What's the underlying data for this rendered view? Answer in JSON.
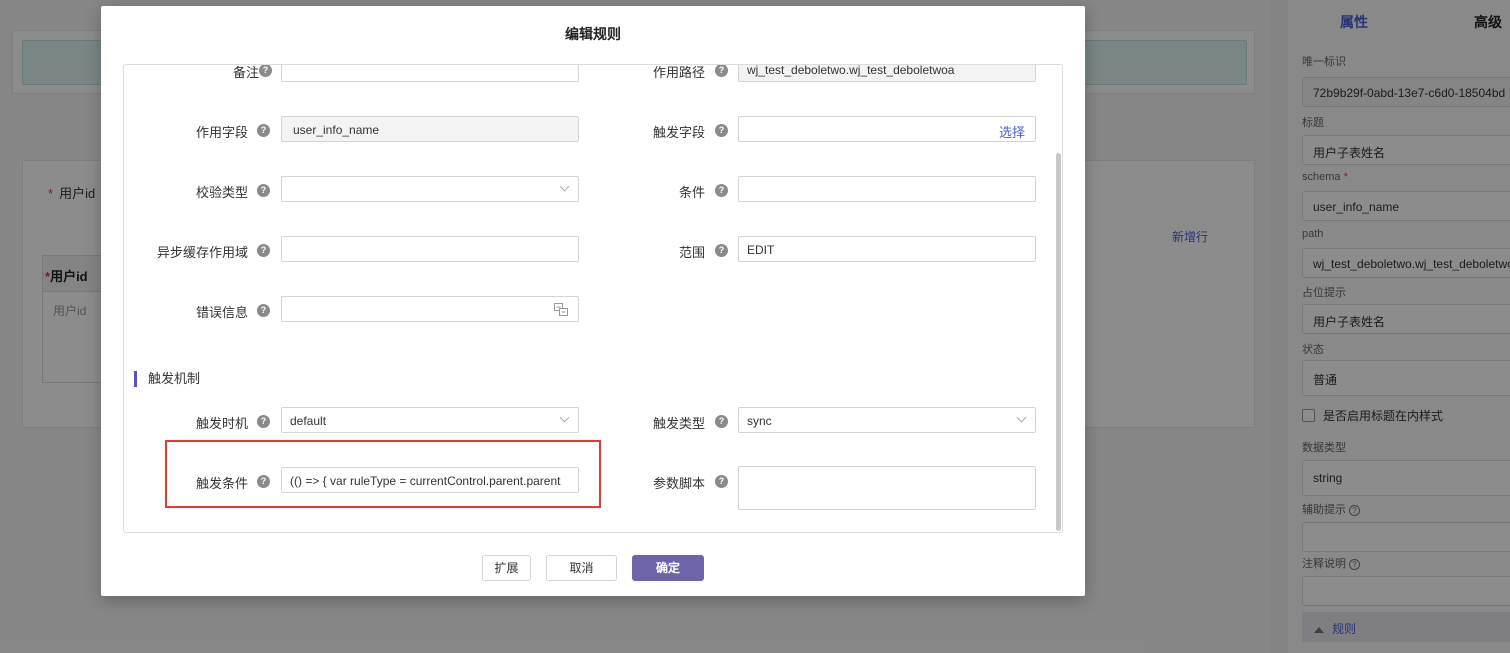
{
  "background": {
    "userid_label": "用户id",
    "new_row": "新增行",
    "table_header": "用户id",
    "table_cell_placeholder": "用户id"
  },
  "props": {
    "tab_attributes": "属性",
    "tab_advanced": "高级",
    "unique_id_label": "唯一标识",
    "unique_id_value": "72b9b29f-0abd-13e7-c6d0-18504bd",
    "title_label": "标题",
    "title_value": "用户子表姓名",
    "schema_label": "schema",
    "schema_value": "user_info_name",
    "path_label": "path",
    "path_value": "wj_test_deboletwo.wj_test_deboletwo",
    "placeholder_label": "占位提示",
    "placeholder_value": "用户子表姓名",
    "status_label": "状态",
    "status_value": "普通",
    "inline_title_label": "是否启用标题在内样式",
    "data_type_label": "数据类型",
    "data_type_value": "string",
    "helper_label": "辅助提示",
    "annotation_label": "注释说明",
    "rules_label": "规则"
  },
  "modal": {
    "title": "编辑规则",
    "fields": {
      "remark_label": "备注",
      "remark_value": "",
      "path_label": "作用路径",
      "path_value": "wj_test_deboletwo.wj_test_deboletwoa",
      "field_label": "作用字段",
      "field_value": "user_info_name",
      "trigger_field_label": "触发字段",
      "trigger_field_pick": "选择",
      "validate_type_label": "校验类型",
      "condition_label": "条件",
      "async_cache_label": "异步缓存作用域",
      "scope_label": "范围",
      "scope_value": "EDIT",
      "error_label": "错误信息"
    },
    "trigger_section": {
      "title": "触发机制",
      "timing_label": "触发时机",
      "timing_value": "default",
      "type_label": "触发类型",
      "type_value": "sync",
      "condition_label": "触发条件",
      "condition_value": "(() => {     var ruleType = currentControl.parent.parent",
      "script_label": "参数脚本"
    },
    "buttons": {
      "expand": "扩展",
      "cancel": "取消",
      "confirm": "确定"
    }
  },
  "colors": {
    "accent": "#4a5fd6",
    "primary_button": "#6c63a8",
    "highlight_box": "#e53935"
  }
}
